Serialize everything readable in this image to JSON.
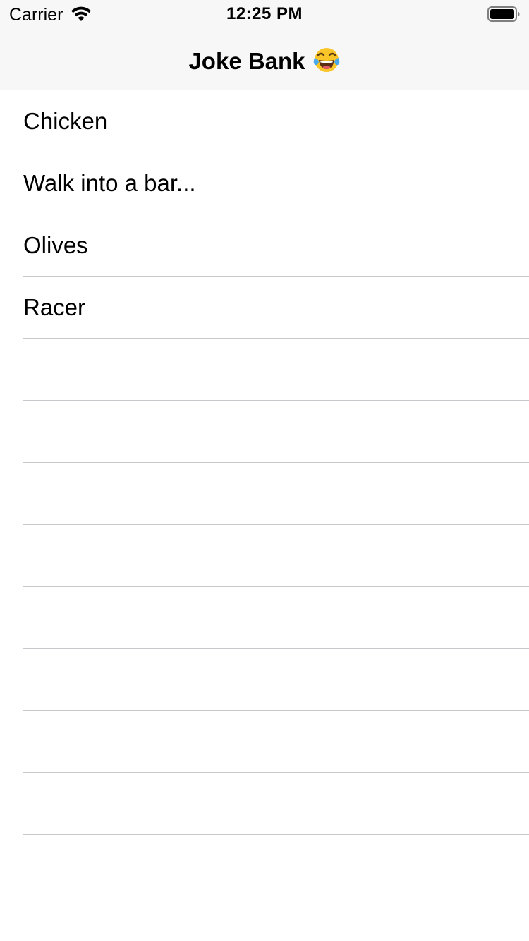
{
  "status_bar": {
    "carrier": "Carrier",
    "time": "12:25 PM",
    "wifi_icon": "wifi-icon",
    "battery_icon": "battery-full-icon"
  },
  "nav_bar": {
    "title": "Joke Bank",
    "title_emoji_icon": "face-with-tears-of-joy-icon"
  },
  "table": {
    "rows": [
      {
        "label": "Chicken"
      },
      {
        "label": "Walk into a bar..."
      },
      {
        "label": "Olives"
      },
      {
        "label": "Racer"
      },
      {
        "label": ""
      },
      {
        "label": ""
      },
      {
        "label": ""
      },
      {
        "label": ""
      },
      {
        "label": ""
      },
      {
        "label": ""
      },
      {
        "label": ""
      },
      {
        "label": ""
      },
      {
        "label": ""
      },
      {
        "label": ""
      }
    ]
  },
  "colors": {
    "bar_background": "#f7f7f7",
    "separator": "#c8c7cc",
    "text": "#000000"
  }
}
